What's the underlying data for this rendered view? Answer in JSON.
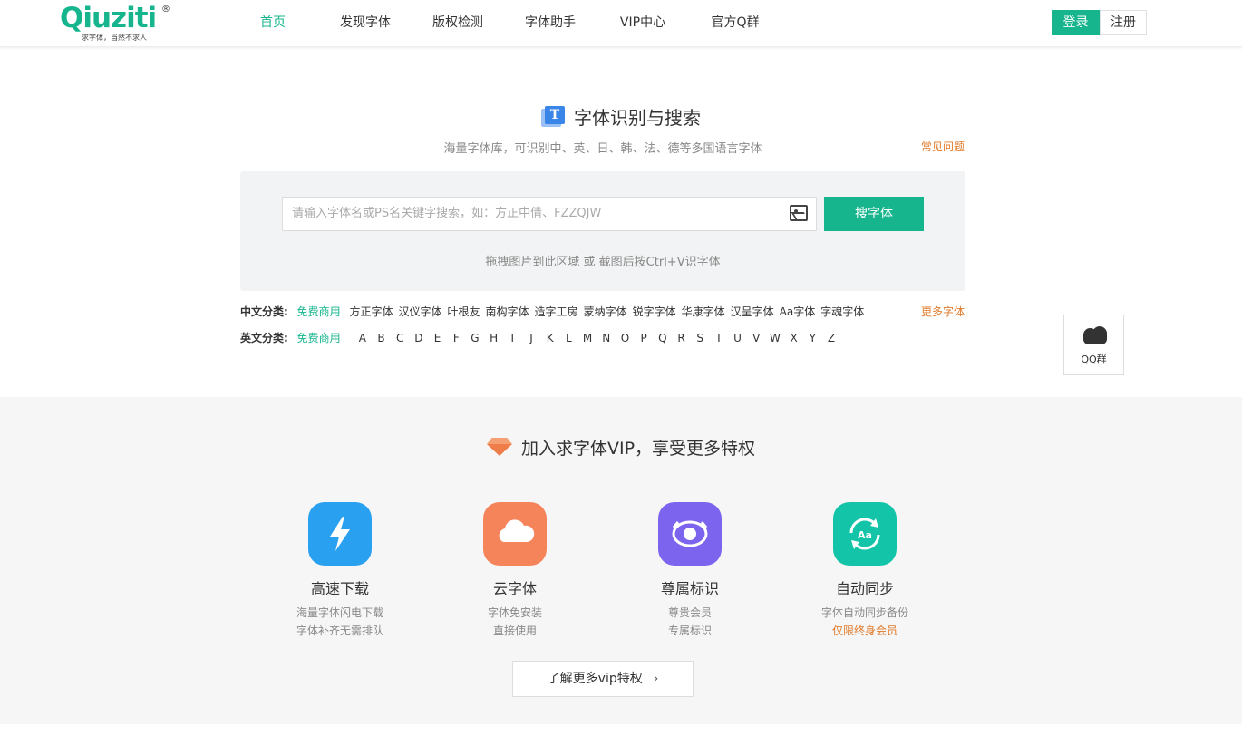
{
  "header": {
    "logo_text": "Qiuziti",
    "logo_reg": "®",
    "logo_tagline": "求字体，当然不求人",
    "nav": [
      {
        "label": "首页",
        "active": true
      },
      {
        "label": "发现字体",
        "active": false
      },
      {
        "label": "版权检测",
        "active": false
      },
      {
        "label": "字体助手",
        "active": false
      },
      {
        "label": "VIP中心",
        "active": false
      },
      {
        "label": "官方Q群",
        "active": false
      }
    ],
    "login_label": "登录",
    "register_label": "注册"
  },
  "search": {
    "icon_letter": "T",
    "title": "字体识别与搜索",
    "subtitle": "海量字体库，可识别中、英、日、韩、法、德等多国语言字体",
    "faq_label": "常见问题",
    "placeholder": "请输入字体名或PS名关键字搜索，如：方正中倩、FZZQJW",
    "button_label": "搜字体",
    "drag_hint": "拖拽图片到此区域 或 截图后按Ctrl+V识字体"
  },
  "categories": {
    "chinese_label": "中文分类:",
    "chinese_free": "免费商用",
    "chinese_items": [
      "方正字体",
      "汉仪字体",
      "叶根友",
      "南构字体",
      "造字工房",
      "蒙纳字体",
      "锐字字体",
      "华康字体",
      "汉呈字体",
      "Aa字体",
      "字魂字体"
    ],
    "more_label": "更多字体",
    "english_label": "英文分类:",
    "english_free": "免费商用",
    "letters": [
      "A",
      "B",
      "C",
      "D",
      "E",
      "F",
      "G",
      "H",
      "I",
      "J",
      "K",
      "L",
      "M",
      "N",
      "O",
      "P",
      "Q",
      "R",
      "S",
      "T",
      "U",
      "V",
      "W",
      "X",
      "Y",
      "Z"
    ]
  },
  "float": {
    "qq_label": "QQ群"
  },
  "vip": {
    "title": "加入求字体VIP，享受更多特权",
    "features": [
      {
        "title": "高速下载",
        "desc1": "海量字体闪电下载",
        "desc2": "字体补齐无需排队",
        "icon": "lightning-icon",
        "color": "#2aa0f0"
      },
      {
        "title": "云字体",
        "desc1": "字体免安装",
        "desc2": "直接使用",
        "icon": "cloud-icon",
        "color": "#f5845a"
      },
      {
        "title": "尊属标识",
        "desc1": "尊贵会员",
        "desc2": "专属标识",
        "icon": "badge-icon",
        "color": "#7c64ee"
      },
      {
        "title": "自动同步",
        "desc1": "字体自动同步备份",
        "desc2": "仅限终身会员",
        "icon": "sync-icon",
        "color": "#14c4a8"
      }
    ],
    "more_label": "了解更多vip特权",
    "more_chevron": "›"
  },
  "colors": {
    "brand": "#17b58d",
    "accent_orange": "#e07a2a"
  }
}
